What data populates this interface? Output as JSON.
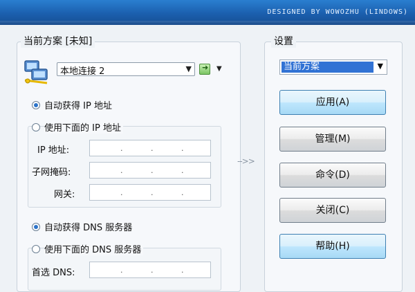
{
  "window": {
    "credit": "DESIGNED BY WOWOZHU (LINDOWS)"
  },
  "left_group": {
    "title": "当前方案 [未知]",
    "connection": {
      "selected": "本地连接 2"
    },
    "ip": {
      "auto_label": "自动获得 IP 地址",
      "auto_selected": true,
      "manual_label": "使用下面的 IP 地址",
      "address_label": "IP 地址:",
      "subnet_label": "子网掩码:",
      "gateway_label": "网关:"
    },
    "dns": {
      "auto_label": "自动获得 DNS 服务器",
      "auto_selected": true,
      "manual_label": "使用下面的 DNS 服务器",
      "preferred_label": "首选 DNS:"
    }
  },
  "right_group": {
    "title": "设置",
    "scheme": {
      "selected": "当前方案"
    },
    "buttons": {
      "apply": "应用(A)",
      "manage": "管理(M)",
      "command": "命令(D)",
      "close": "关闭(C)",
      "help": "帮助(H)"
    }
  },
  "flow_arrow": "-->>",
  "icons": {
    "network": "network-connection-icon",
    "go": "go-arrow-icon",
    "dropdown": "chevron-down-icon"
  },
  "colors": {
    "title_bar": "#1b5fae",
    "selection": "#3172d4",
    "radio_dot": "#2c73c9"
  }
}
